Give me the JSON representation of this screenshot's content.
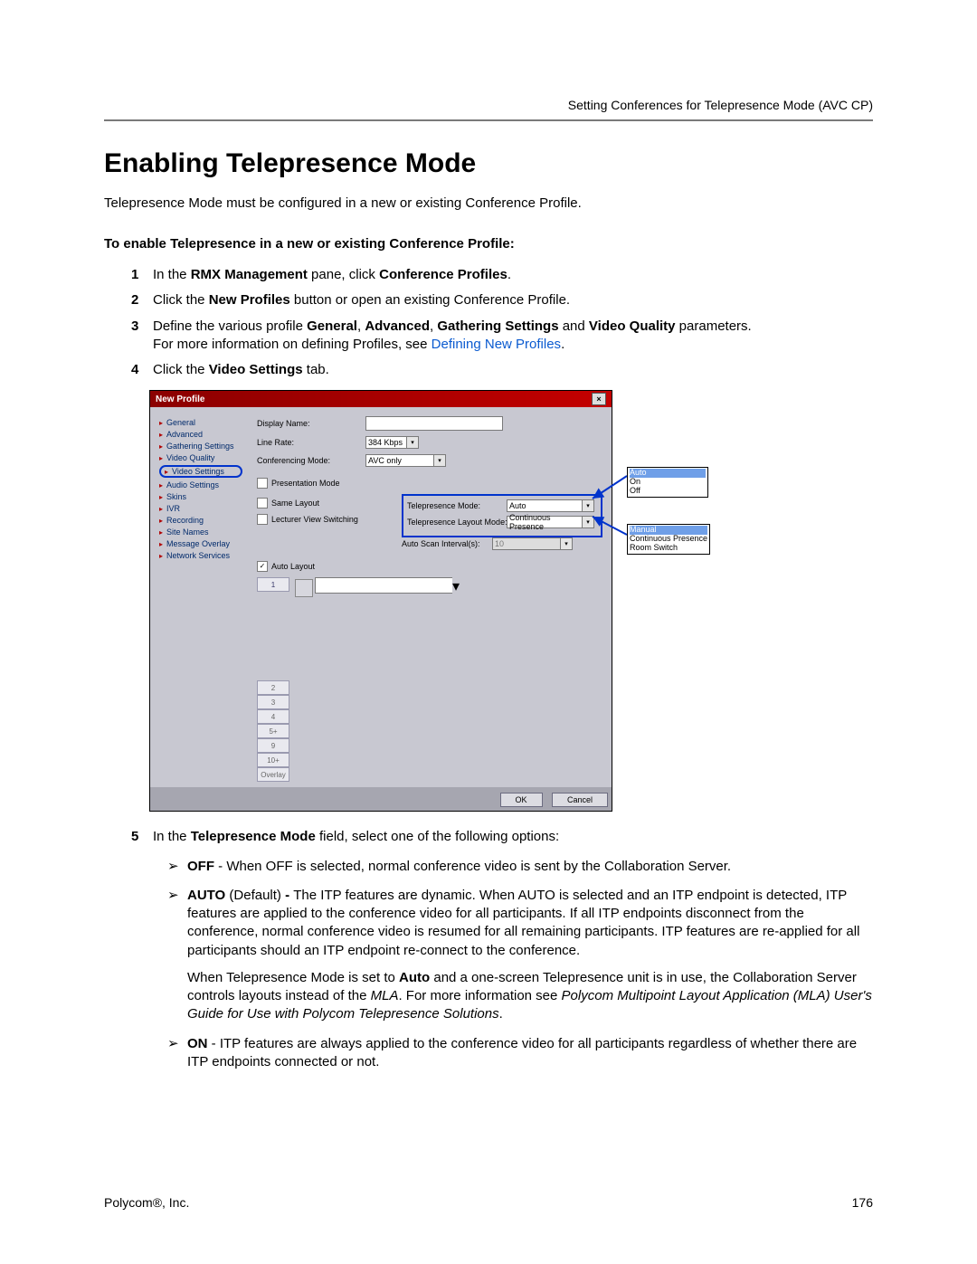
{
  "header": {
    "text": "Setting Conferences for Telepresence Mode (AVC CP)"
  },
  "title": "Enabling Telepresence Mode",
  "intro": "Telepresence Mode must be configured in a new or existing Conference Profile.",
  "subhead": "To enable Telepresence in a new or existing Conference Profile:",
  "steps": {
    "s1": {
      "n": "1",
      "pre": "In the ",
      "b1": "RMX Management",
      "mid": " pane, click ",
      "b2": "Conference Profiles",
      "post": "."
    },
    "s2": {
      "n": "2",
      "pre": "Click the ",
      "b1": "New Profiles",
      "post": " button or open an existing Conference Profile."
    },
    "s3": {
      "n": "3",
      "pre": "Define the various profile ",
      "b1": "General",
      "c": ", ",
      "b2": "Advanced",
      "c2": ", ",
      "b3": "Gathering Settings",
      "a": " and ",
      "b4": "Video Quality",
      "post": " parameters.",
      "line2_pre": "For more information on defining Profiles, see ",
      "link": "Defining New Profiles",
      "line2_post": "."
    },
    "s4": {
      "n": "4",
      "pre": "Click the ",
      "b1": "Video Settings",
      "post": " tab."
    },
    "s5": {
      "n": "5",
      "pre": "In the ",
      "b1": "Telepresence Mode",
      "post": " field, select one of the following options:"
    }
  },
  "dialog": {
    "title": "New Profile",
    "nav": [
      "General",
      "Advanced",
      "Gathering Settings",
      "Video Quality",
      "Video Settings",
      "Audio Settings",
      "Skins",
      "IVR",
      "Recording",
      "Site Names",
      "Message Overlay",
      "Network Services"
    ],
    "fields": {
      "display_name": "Display Name:",
      "line_rate": "Line Rate:",
      "line_rate_val": "384 Kbps",
      "conf_mode": "Conferencing Mode:",
      "conf_mode_val": "AVC only",
      "presentation": "Presentation Mode",
      "same_layout": "Same Layout",
      "lecturer": "Lecturer View Switching",
      "tp_mode_label": "Telepresence Mode:",
      "tp_mode_val": "Auto",
      "tp_layout_label": "Telepresence Layout Mode:",
      "tp_layout_val": "Continuous Presence",
      "auto_scan_label": "Auto Scan Interval(s):",
      "auto_scan_val": "10",
      "auto_layout": "Auto Layout",
      "parts": [
        "1",
        "2",
        "3",
        "4",
        "5+",
        "9",
        "10+",
        "Overlay"
      ],
      "ok": "OK",
      "cancel": "Cancel"
    },
    "callout_mode": {
      "opt1": "Auto",
      "opt2": "On",
      "opt3": "Off"
    },
    "callout_layout": {
      "opt1": "Manual",
      "opt2": "Continuous Presence",
      "opt3": "Room Switch"
    }
  },
  "options": {
    "off": {
      "label": "OFF",
      "text": " - When OFF is selected, normal conference video is sent by the Collaboration Server."
    },
    "auto_label": "AUTO",
    "auto_def": " (Default) ",
    "auto_dash": "- ",
    "auto_text": "The ITP features are dynamic. When AUTO is selected and an ITP endpoint is detected, ITP features are applied to the conference video for all participants. If all ITP endpoints disconnect from the conference, normal conference video is resumed for all remaining participants. ITP features are re-applied for all participants should an ITP endpoint re-connect to the conference.",
    "auto_p2_pre": "When Telepresence Mode is set to ",
    "auto_p2_b1": "Auto",
    "auto_p2_mid": " and a one-screen Telepresence unit is in use, the Collaboration Server controls layouts instead of the ",
    "auto_p2_i1": "MLA",
    "auto_p2_mid2": ". For more information see ",
    "auto_p2_i2": "Polycom Multipoint Layout Application (MLA) User's Guide for Use with Polycom Telepresence Solutions",
    "auto_p2_post": ".",
    "on": {
      "label": "ON",
      "text": " - ITP features are always applied to the conference video for all participants regardless of whether there are ITP endpoints connected or not."
    }
  },
  "footer": {
    "company": "Polycom",
    "reg": "®",
    "suffix": ", Inc.",
    "page": "176"
  }
}
